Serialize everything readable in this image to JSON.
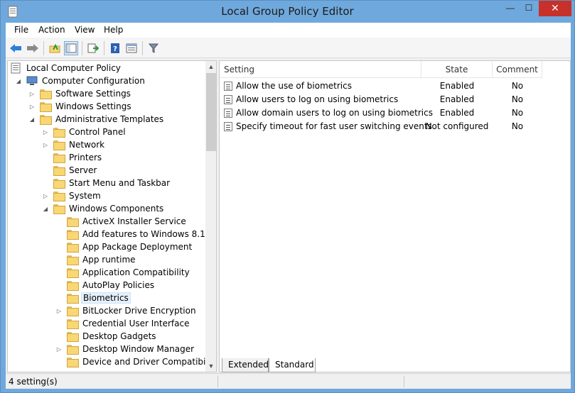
{
  "window": {
    "title": "Local Group Policy Editor",
    "minimize": "—",
    "maximize": "☐",
    "close": "✕"
  },
  "menu": [
    "File",
    "Action",
    "View",
    "Help"
  ],
  "toolbar": [
    "back-icon",
    "forward-icon",
    "up-folder-icon",
    "show-hide-tree-icon",
    "export-list-icon",
    "help-icon",
    "properties-icon",
    "filter-icon"
  ],
  "tree": {
    "root": "Local Computer Policy",
    "computer_configuration": "Computer Configuration",
    "software_settings": "Software Settings",
    "windows_settings": "Windows Settings",
    "administrative_templates": "Administrative Templates",
    "control_panel": "Control Panel",
    "network": "Network",
    "printers": "Printers",
    "server": "Server",
    "start_menu_taskbar": "Start Menu and Taskbar",
    "system": "System",
    "windows_components": "Windows Components",
    "activex": "ActiveX Installer Service",
    "add_features": "Add features to Windows 8.1",
    "app_package": "App Package Deployment",
    "app_runtime": "App runtime",
    "app_compat": "Application Compatibility",
    "autoplay": "AutoPlay Policies",
    "biometrics": "Biometrics",
    "bitlocker": "BitLocker Drive Encryption",
    "credential_ui": "Credential User Interface",
    "desktop_gadgets": "Desktop Gadgets",
    "desktop_window_manager": "Desktop Window Manager",
    "cut_off": "Device and Driver Compatibility"
  },
  "list": {
    "headers": {
      "setting": "Setting",
      "state": "State",
      "comment": "Comment"
    },
    "rows": [
      {
        "setting": "Allow the use of biometrics",
        "state": "Enabled",
        "comment": "No"
      },
      {
        "setting": "Allow users to log on using biometrics",
        "state": "Enabled",
        "comment": "No"
      },
      {
        "setting": "Allow domain users to log on using biometrics",
        "state": "Enabled",
        "comment": "No"
      },
      {
        "setting": "Specify timeout for fast user switching events",
        "state": "Not configured",
        "comment": "No"
      }
    ]
  },
  "tabs": {
    "extended": "Extended",
    "standard": "Standard"
  },
  "status": {
    "text": "4 setting(s)"
  }
}
